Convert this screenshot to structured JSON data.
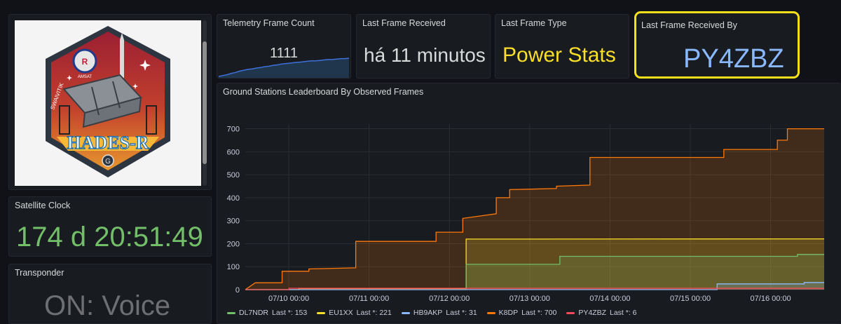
{
  "image_panel": {
    "patch_text": "HADES-R",
    "patch_small": "AMSAT",
    "patch_side": "SWAIVITIK",
    "patch_logo": "G"
  },
  "clock": {
    "title": "Satellite Clock",
    "value": "174 d 20:51:49"
  },
  "transponder": {
    "title": "Transponder",
    "value": "ON: Voice"
  },
  "frame_count": {
    "title": "Telemetry Frame Count",
    "value": "1111"
  },
  "last_received": {
    "title": "Last Frame Received",
    "value": "há 11 minutos"
  },
  "frame_type": {
    "title": "Last Frame Type",
    "value": "Power Stats"
  },
  "received_by": {
    "title": "Last Frame Received By",
    "value": "PY4ZBZ"
  },
  "colors": {
    "green": "#73bf69",
    "yellow": "#fade2a",
    "blue": "#8ab8ff",
    "orange": "#ff780a",
    "red": "#f2495c",
    "highlight": "#f5e11a"
  },
  "chart": {
    "title": "Ground Stations Leaderboard By Observed Frames"
  },
  "chart_data": {
    "type": "area",
    "title": "Ground Stations Leaderboard By Observed Frames",
    "x_ticks": [
      "07/10 00:00",
      "07/11 00:00",
      "07/12 00:00",
      "07/13 00:00",
      "07/14 00:00",
      "07/15 00:00",
      "07/16 00:00"
    ],
    "y_ticks": [
      0,
      100,
      200,
      300,
      400,
      500,
      600,
      700
    ],
    "xlim": [
      "07/09 11:00",
      "07/16 16:00"
    ],
    "ylim": [
      0,
      720
    ],
    "grid": true,
    "legend_position": "bottom",
    "series": [
      {
        "name": "DL7NDR",
        "last_label": "Last *: 153",
        "color": "#73bf69",
        "points": [
          [
            "07/09 11:00",
            0
          ],
          [
            "07/12 05:00",
            0
          ],
          [
            "07/12 05:00",
            110
          ],
          [
            "07/13 09:00",
            110
          ],
          [
            "07/13 09:00",
            145
          ],
          [
            "07/16 08:00",
            145
          ],
          [
            "07/16 08:00",
            153
          ],
          [
            "07/16 16:00",
            153
          ]
        ]
      },
      {
        "name": "EU1XX",
        "last_label": "Last *: 221",
        "color": "#fade2a",
        "points": [
          [
            "07/09 11:00",
            0
          ],
          [
            "07/10 03:00",
            0
          ],
          [
            "07/10 03:00",
            5
          ],
          [
            "07/12 05:00",
            5
          ],
          [
            "07/12 05:00",
            220
          ],
          [
            "07/16 16:00",
            221
          ]
        ]
      },
      {
        "name": "HB9AKP",
        "last_label": "Last *: 31",
        "color": "#8ab8ff",
        "points": [
          [
            "07/09 11:00",
            0
          ],
          [
            "07/15 08:00",
            0
          ],
          [
            "07/15 08:00",
            25
          ],
          [
            "07/16 10:00",
            25
          ],
          [
            "07/16 10:00",
            31
          ],
          [
            "07/16 16:00",
            31
          ]
        ]
      },
      {
        "name": "K8DP",
        "last_label": "Last *: 700",
        "color": "#ff780a",
        "points": [
          [
            "07/09 11:00",
            0
          ],
          [
            "07/09 14:00",
            30
          ],
          [
            "07/09 22:00",
            30
          ],
          [
            "07/09 22:00",
            80
          ],
          [
            "07/10 06:00",
            80
          ],
          [
            "07/10 06:00",
            90
          ],
          [
            "07/10 20:00",
            95
          ],
          [
            "07/10 20:00",
            210
          ],
          [
            "07/11 20:00",
            210
          ],
          [
            "07/11 20:00",
            250
          ],
          [
            "07/12 04:00",
            250
          ],
          [
            "07/12 04:00",
            310
          ],
          [
            "07/12 14:00",
            330
          ],
          [
            "07/12 14:00",
            400
          ],
          [
            "07/12 18:00",
            400
          ],
          [
            "07/12 18:00",
            435
          ],
          [
            "07/13 08:00",
            440
          ],
          [
            "07/13 08:00",
            450
          ],
          [
            "07/13 18:00",
            455
          ],
          [
            "07/13 18:00",
            575
          ],
          [
            "07/15 10:00",
            575
          ],
          [
            "07/15 10:00",
            610
          ],
          [
            "07/16 02:00",
            610
          ],
          [
            "07/16 02:00",
            650
          ],
          [
            "07/16 05:00",
            650
          ],
          [
            "07/16 05:00",
            700
          ],
          [
            "07/16 16:00",
            700
          ]
        ]
      },
      {
        "name": "PY4ZBZ",
        "last_label": "Last *: 6",
        "color": "#f2495c",
        "points": [
          [
            "07/09 11:00",
            0
          ],
          [
            "07/10 00:00",
            0
          ],
          [
            "07/10 00:00",
            6
          ],
          [
            "07/16 16:00",
            6
          ]
        ]
      }
    ]
  },
  "sparkline": [
    70,
    72,
    74,
    77,
    79,
    82,
    84,
    86,
    87,
    89,
    90,
    92,
    93,
    95,
    96,
    98,
    99,
    100,
    101,
    102,
    103,
    104,
    105,
    105,
    106,
    107,
    108,
    108,
    109,
    110,
    110,
    111
  ]
}
